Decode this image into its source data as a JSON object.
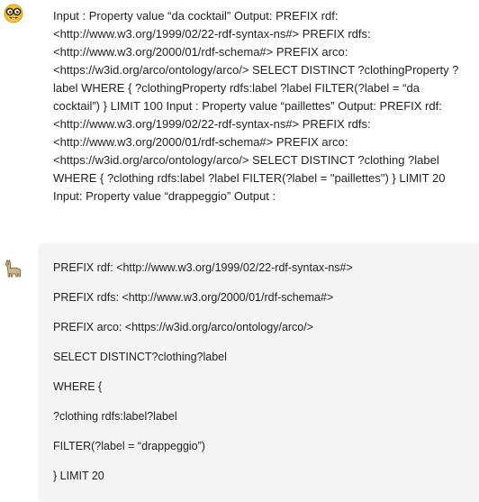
{
  "conversation": {
    "user_message": {
      "avatar_icon": "nerd-face-icon",
      "text": "Input : Property value “da cocktail” Output: PREFIX rdf: <http://www.w3.org/1999/02/22-rdf-syntax-ns#> PREFIX rdfs: <http://www.w3.org/2000/01/rdf-schema#> PREFIX arco: <https://w3id.org/arco/ontology/arco/> SELECT DISTINCT ?clothingProperty ?label WHERE { ?clothingProperty rdfs:label ?label FILTER(?label = “da cocktail”) } LIMIT 100 Input : Property value “paillettes” Output: PREFIX rdf: <http://www.w3.org/1999/02/22-rdf-syntax-ns#> PREFIX rdfs: <http://www.w3.org/2000/01/rdf-schema#> PREFIX arco: <https://w3id.org/arco/ontology/arco/> SELECT DISTINCT ?clothing ?label WHERE { ?clothing rdfs:label ?label FILTER(?label = \"paillettes\") } LIMIT 20 Input: Property value “drappeggio” Output :"
    },
    "assistant_message": {
      "avatar_icon": "llama-icon",
      "lines": [
        "PREFIX rdf: <http://www.w3.org/1999/02/22-rdf-syntax-ns#>",
        "PREFIX rdfs: <http://www.w3.org/2000/01/rdf-schema#>",
        "PREFIX arco: <https://w3id.org/arco/ontology/arco/>",
        "SELECT DISTINCT?clothing?label",
        "WHERE {",
        "?clothing rdfs:label?label",
        "FILTER(?label = “drappeggio”)",
        "} LIMIT 20"
      ]
    }
  }
}
